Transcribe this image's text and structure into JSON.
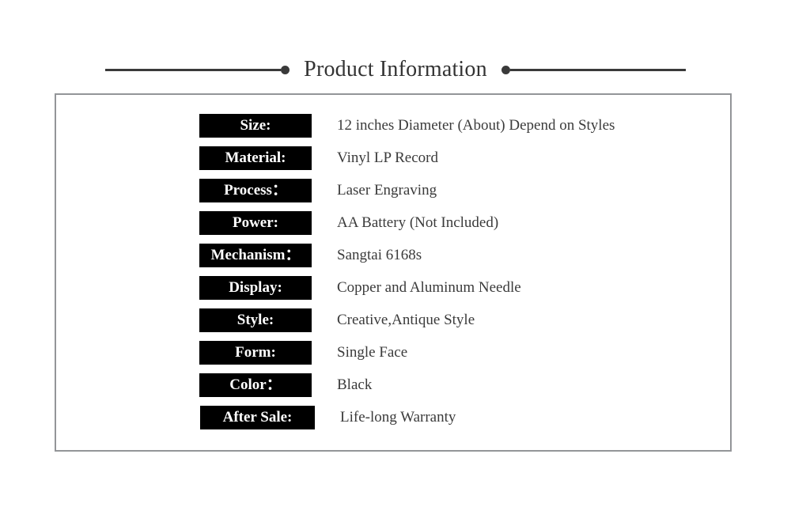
{
  "header": {
    "title": "Product Information",
    "left_dot_icon": "bullet-dot-icon",
    "right_dot_icon": "bullet-dot-icon",
    "rule_color": "#3a3a3a",
    "title_color": "#333333"
  },
  "panel": {
    "border_color": "#939598",
    "background": "#ffffff"
  },
  "specs": {
    "label_background": "#000000",
    "label_color": "#ffffff",
    "value_color": "#3b3b3b",
    "rows": [
      {
        "label": "Size:",
        "value": "12 inches Diameter (About) Depend on Styles"
      },
      {
        "label": "Material:",
        "value": "Vinyl LP Record"
      },
      {
        "label": "Process：",
        "value": "Laser Engraving"
      },
      {
        "label": "Power:",
        "value": "AA Battery (Not Included)"
      },
      {
        "label": "Mechanism：",
        "value": "Sangtai 6168s"
      },
      {
        "label": "Display:",
        "value": "Copper and Aluminum Needle"
      },
      {
        "label": "Style:",
        "value": "Creative,Antique Style"
      },
      {
        "label": "Form:",
        "value": "Single Face"
      },
      {
        "label": "Color：",
        "value": "Black"
      },
      {
        "label": "After Sale:",
        "value": "Life-long Warranty"
      }
    ]
  }
}
